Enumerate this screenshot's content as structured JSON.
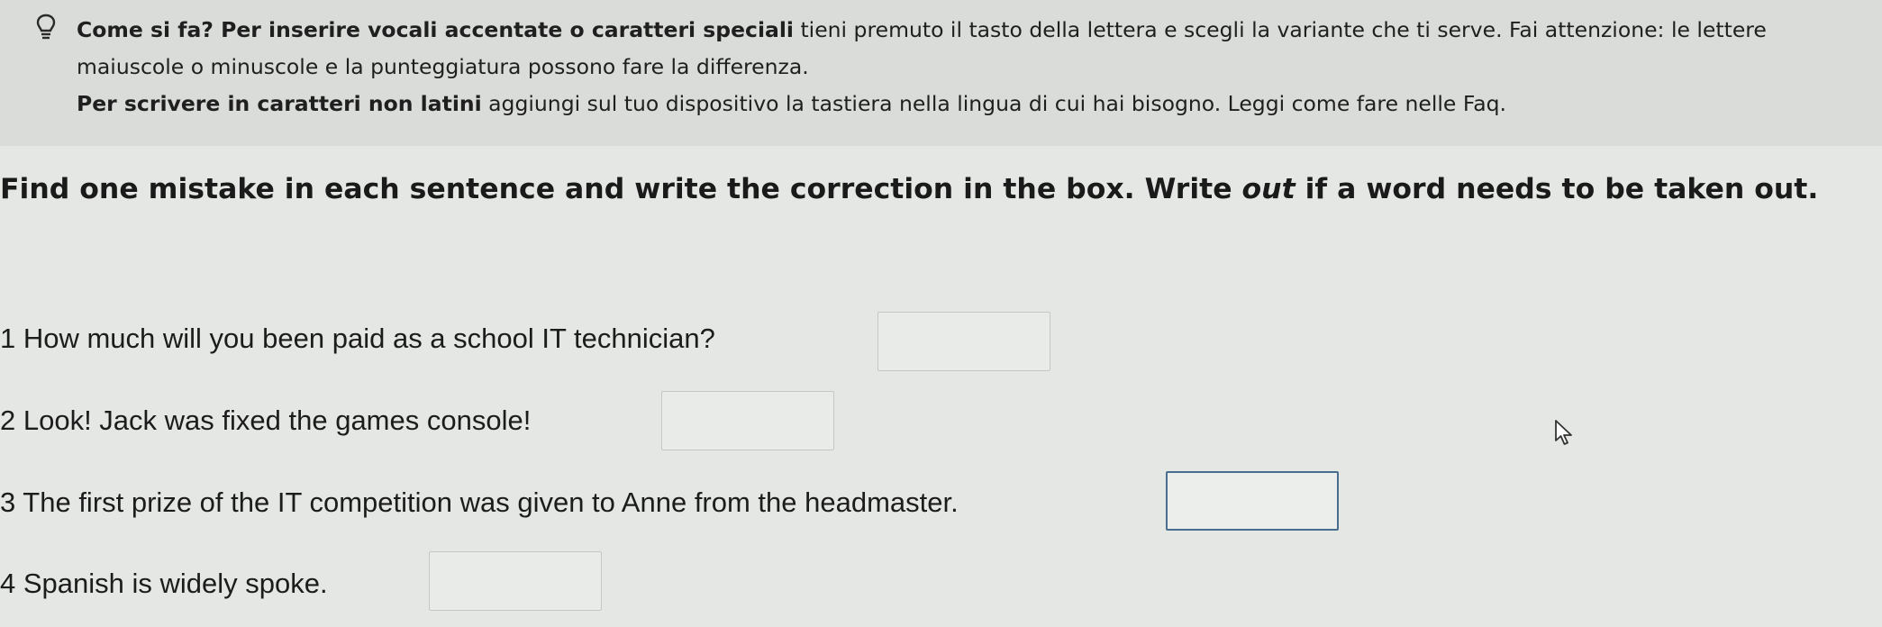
{
  "hint": {
    "icon": "lightbulb-icon",
    "lead_bold": "Come si fa? Per inserire vocali accentate o caratteri speciali",
    "lead_rest": " tieni premuto il tasto della lettera e scegli la variante che ti serve. Fai attenzione: le lettere",
    "line2": "maiuscole o minuscole e la punteggiatura possono fare la differenza.",
    "line3_bold": "Per scrivere in caratteri non latini",
    "line3_rest": " aggiungi sul tuo dispositivo la tastiera nella lingua di cui hai bisogno. Leggi come fare nelle Faq."
  },
  "instruction": {
    "before": "Find one mistake in each sentence and write the correction in the box. Write ",
    "italic": "out",
    "after": " if a word needs to be taken out."
  },
  "questions": [
    {
      "text": "1 How much will you been paid as a school IT technician?",
      "answer": ""
    },
    {
      "text": "2 Look! Jack was fixed the games console!",
      "answer": ""
    },
    {
      "text": "3 The first prize of the IT competition was given to Anne from the headmaster.",
      "answer": ""
    },
    {
      "text": "4 Spanish is widely spoke.",
      "answer": ""
    }
  ],
  "cursor": {
    "icon": "mouse-pointer-icon"
  }
}
